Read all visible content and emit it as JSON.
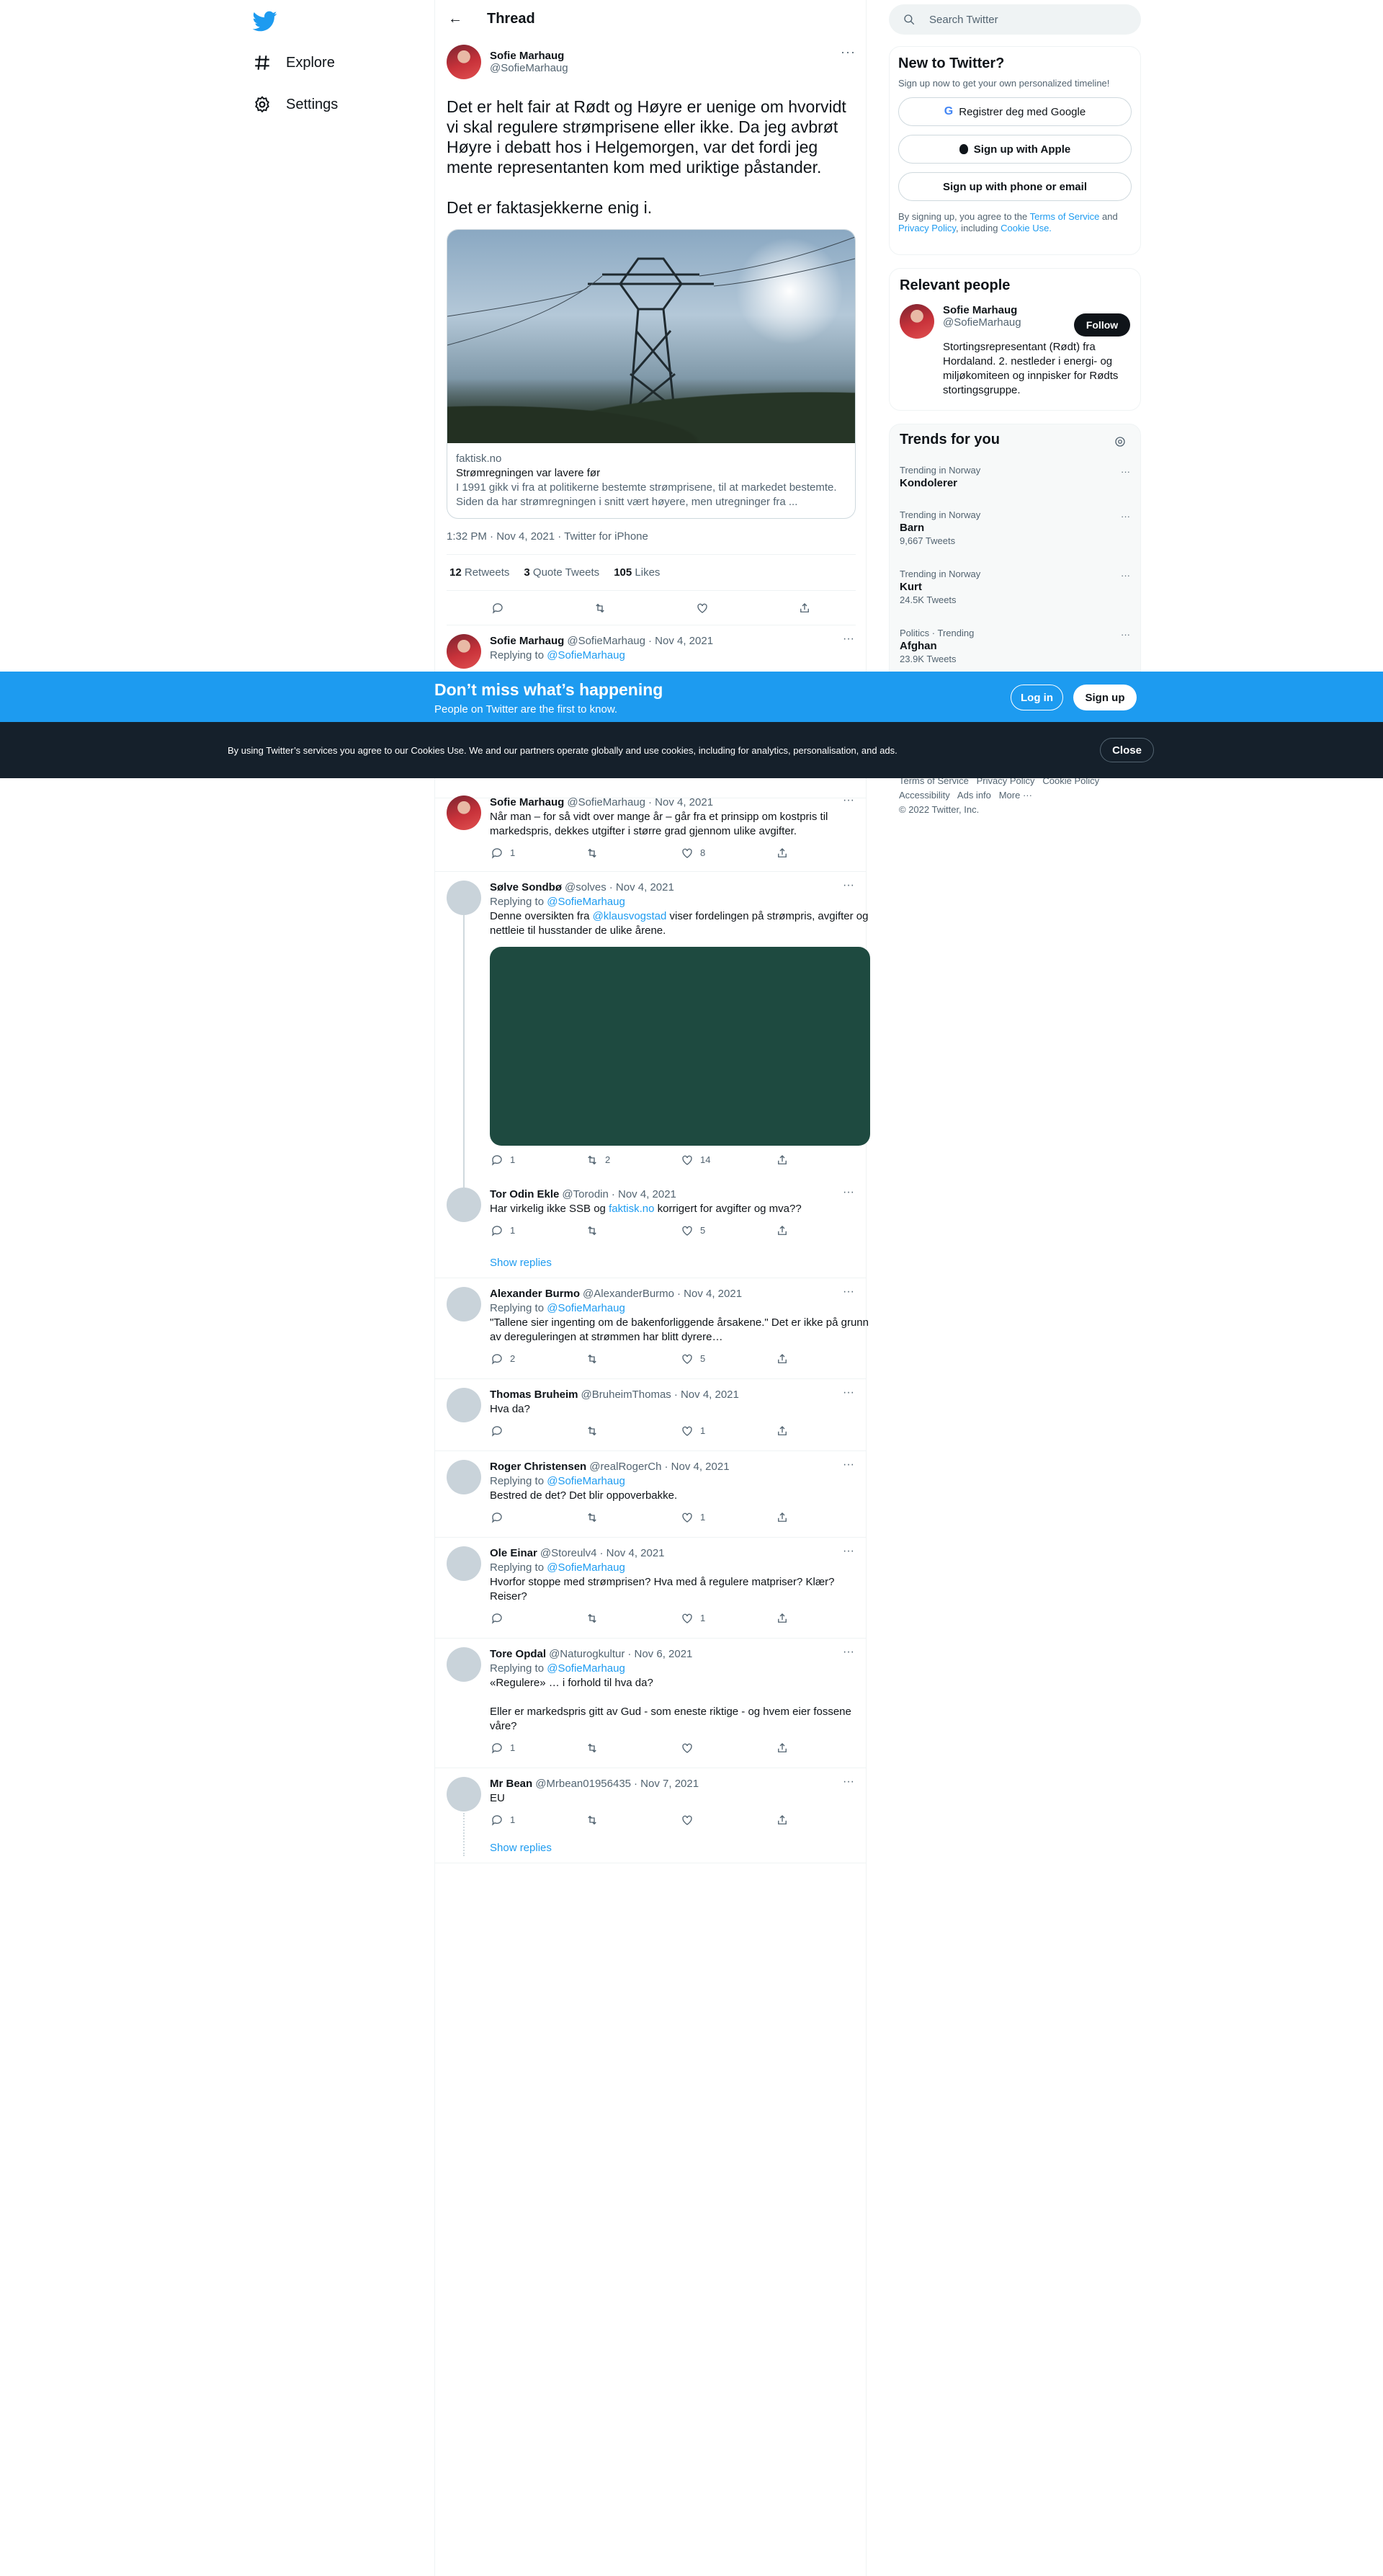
{
  "nav": {
    "explore": "Explore",
    "settings": "Settings"
  },
  "header": {
    "title": "Thread"
  },
  "focal": {
    "name": "Sofie Marhaug",
    "handle": "@SofieMarhaug",
    "text": "Det er helt fair at Rødt og Høyre er uenige om hvorvidt vi skal regulere strømprisene eller ikke. Da jeg avbrøt Høyre i debatt hos i Helgemorgen, var det fordi jeg mente representanten kom med uriktige påstander.\n\nDet er faktasjekkerne enig i.",
    "card": {
      "domain": "faktisk.no",
      "title": "Strømregningen var lavere før",
      "desc": "I 1991 gikk vi fra at politikerne bestemte strømprisene, til at markedet bestemte. Siden da har strømregningen i snitt vært høyere, men utregninger fra ..."
    },
    "meta": "1:32 PM · Nov 4, 2021 · Twitter for iPhone",
    "stats": {
      "retweets": "12",
      "retweets_label": "Retweets",
      "quotes": "3",
      "quotes_label": "Quote Tweets",
      "likes": "105",
      "likes_label": "Likes"
    }
  },
  "replies": [
    {
      "name": "Sofie Marhaug",
      "handle": "@SofieMarhaug",
      "date": "· Nov 4, 2021",
      "replying": "Replying to",
      "to": "@SofieMarhaug",
      "text": "",
      "reply": "",
      "rt": "",
      "like": ""
    },
    {
      "name": "Sofie Marhaug",
      "handle": "@SofieMarhaug",
      "date": "· Nov 4, 2021",
      "text": "Når man – for så vidt over mange år – går fra et prinsipp om kostpris til markedspris, dekkes utgifter i større grad gjennom ulike avgifter.",
      "reply": "1",
      "rt": "",
      "like": "8"
    },
    {
      "name": "Sølve Sondbø",
      "handle": "@solves",
      "date": "· Nov 4, 2021",
      "replying": "Replying to",
      "to": "@SofieMarhaug",
      "text_pre": "Denne oversikten fra ",
      "mention": "@klausvogstad",
      "text_post": " viser fordelingen på strømpris, avgifter og nettleie til husstander de ulike årene.",
      "reply": "1",
      "rt": "2",
      "like": "14"
    },
    {
      "name": "Tor Odin Ekle",
      "handle": "@Torodin",
      "date": "· Nov 4, 2021",
      "text_pre": "Har virkelig ikke SSB og ",
      "mention": "faktisk.no",
      "text_post": " korrigert for avgifter og mva??",
      "reply": "1",
      "rt": "",
      "like": "5"
    },
    {
      "name": "Alexander Burmo",
      "handle": "@AlexanderBurmo",
      "date": "· Nov 4, 2021",
      "replying": "Replying to",
      "to": "@SofieMarhaug",
      "text": "\"Tallene sier ingenting om de bakenforliggende årsakene.\" Det er ikke på grunn av dereguleringen at strømmen har blitt dyrere…",
      "reply": "2",
      "rt": "",
      "like": "5"
    },
    {
      "name": "Thomas Bruheim",
      "handle": "@BruheimThomas",
      "date": "· Nov 4, 2021",
      "text": "Hva da?",
      "reply": "",
      "rt": "",
      "like": "1"
    },
    {
      "name": "Roger Christensen",
      "handle": "@realRogerCh",
      "date": "· Nov 4, 2021",
      "replying": "Replying to",
      "to": "@SofieMarhaug",
      "text": "Bestred de det? Det blir oppoverbakke.",
      "reply": "",
      "rt": "",
      "like": "1"
    },
    {
      "name": "Ole Einar",
      "handle": "@Storeulv4",
      "date": "· Nov 4, 2021",
      "replying": "Replying to",
      "to": "@SofieMarhaug",
      "text": "Hvorfor stoppe med strømprisen? Hva med å regulere matpriser? Klær? Reiser?",
      "reply": "",
      "rt": "",
      "like": "1"
    },
    {
      "name": "Tore Opdal",
      "handle": "@Naturogkultur",
      "date": "· Nov 6, 2021",
      "replying": "Replying to",
      "to": "@SofieMarhaug",
      "text": "«Regulere» … i forhold til hva da?\n\nEller er markedspris gitt av Gud - som eneste riktige - og hvem eier fossene våre?",
      "reply": "1",
      "rt": "",
      "like": ""
    },
    {
      "name": "Mr Bean",
      "handle": "@Mrbean01956435",
      "date": "· Nov 7, 2021",
      "text": "EU",
      "reply": "1",
      "rt": "",
      "like": ""
    }
  ],
  "show_replies": "Show replies",
  "search": {
    "placeholder": "Search Twitter"
  },
  "newbox": {
    "title": "New to Twitter?",
    "sub": "Sign up now to get your own personalized timeline!",
    "google": "Registrer deg med Google",
    "apple": "Sign up with Apple",
    "phone": "Sign up with phone or email",
    "terms_pre": "By signing up, you agree to the ",
    "tos": "Terms of Service",
    "and": " and ",
    "privacy": "Privacy Policy",
    "including": ", including ",
    "cookie": "Cookie Use."
  },
  "people": {
    "title": "Relevant people",
    "name": "Sofie Marhaug",
    "handle": "@SofieMarhaug",
    "follow": "Follow",
    "bio": "Stortingsrepresentant (Rødt) fra Hordaland. 2. nestleder i energi- og miljøkomiteen og innpisker for Rødts stortingsgruppe."
  },
  "trends": {
    "title": "Trends for you",
    "items": [
      {
        "context": "Trending in Norway",
        "topic": "Kondolerer",
        "count": ""
      },
      {
        "context": "Trending in Norway",
        "topic": "Barn",
        "count": "9,667 Tweets"
      },
      {
        "context": "Trending in Norway",
        "topic": "Kurt",
        "count": "24.5K Tweets"
      },
      {
        "context": "Politics · Trending",
        "topic": "Afghan",
        "count": "23.9K Tweets"
      }
    ]
  },
  "footer": {
    "line1": "Terms of Service   Privacy Policy   Cookie Policy",
    "line2": "Accessibility   Ads info   More ···",
    "line3": "© 2022 Twitter, Inc."
  },
  "banner": {
    "heading": "Don’t miss what’s happening",
    "sub": "People on Twitter are the first to know.",
    "login": "Log in",
    "signup": "Sign up"
  },
  "cookie_bar": {
    "text": "By using Twitter’s services you agree to our Cookies Use. We and our partners operate globally and use cookies, including for analytics, personalisation, and ads.",
    "close": "Close"
  },
  "colors": {
    "accent": "#1d9bf0",
    "text": "#0f1419",
    "muted": "#536471"
  }
}
